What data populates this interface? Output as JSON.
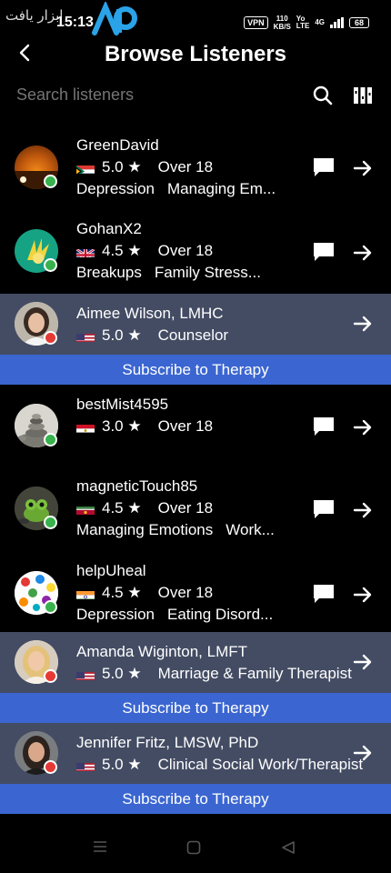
{
  "status_bar": {
    "time": "15:13",
    "vpn": "VPN",
    "speed_top": "110",
    "speed_bottom": "KB/S",
    "net_top": "Yo",
    "net_bottom": "LTE",
    "signal": "4G",
    "battery": "68"
  },
  "header": {
    "title": "Browse Listeners"
  },
  "search": {
    "placeholder": "Search listeners"
  },
  "listeners": [
    {
      "name": "GreenDavid",
      "flag": "south-africa",
      "rating": "5.0 ★",
      "age": "Over 18",
      "tags": [
        "Depression",
        "Managing Em..."
      ],
      "status": "online"
    },
    {
      "name": "GohanX2",
      "flag": "uk",
      "rating": "4.5 ★",
      "age": "Over 18",
      "tags": [
        "Breakups",
        "Family Stress..."
      ],
      "status": "online"
    },
    {
      "name": "Aimee Wilson, LMHC",
      "flag": "us",
      "rating": "5.0 ★",
      "age": "Counselor",
      "status": "offline",
      "subscribe": "Subscribe to Therapy"
    },
    {
      "name": "bestMist4595",
      "flag": "egypt",
      "rating": "3.0 ★",
      "age": "Over 18",
      "status": "online"
    },
    {
      "name": "magneticTouch85",
      "flag": "suriname",
      "rating": "4.5 ★",
      "age": "Over 18",
      "tags": [
        "Managing Emotions",
        "Work..."
      ],
      "status": "online"
    },
    {
      "name": "helpUheal",
      "flag": "india",
      "rating": "4.5 ★",
      "age": "Over 18",
      "tags": [
        "Depression",
        "Eating Disord..."
      ],
      "status": "online"
    },
    {
      "name": "Amanda Wiginton, LMFT",
      "flag": "us",
      "rating": "5.0 ★",
      "age": "Marriage & Family Therapist",
      "status": "offline",
      "subscribe": "Subscribe to Therapy"
    },
    {
      "name": "Jennifer Fritz, LMSW, PhD",
      "flag": "us",
      "rating": "5.0 ★",
      "age": "Clinical Social Work/Therapist",
      "status": "offline",
      "subscribe": "Subscribe to Therapy"
    }
  ],
  "colors": {
    "therapist_row": "#434c63",
    "subscribe": "#3b66d1",
    "online": "#37b24d",
    "offline": "#e53935"
  }
}
